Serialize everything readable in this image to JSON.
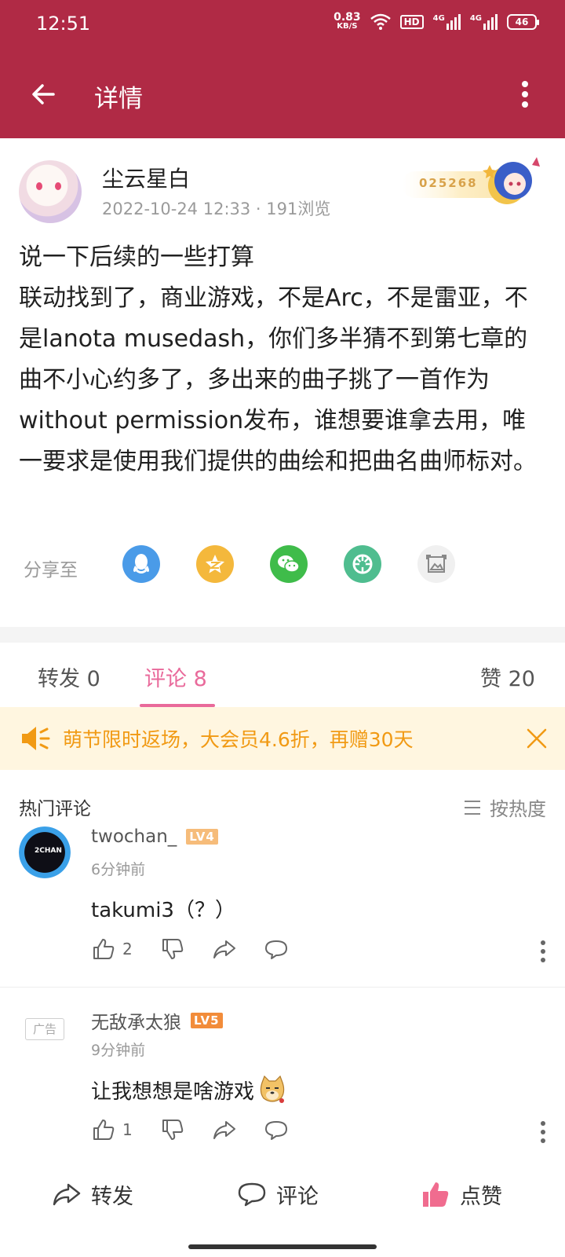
{
  "status": {
    "time": "12:51",
    "net_speed_value": "0.83",
    "net_speed_unit": "KB/S",
    "hd": "HD",
    "net1": "4G",
    "net2": "4G",
    "battery": "46"
  },
  "header": {
    "title": "详情"
  },
  "author": {
    "name": "尘云星白",
    "meta": "2022-10-24 12:33 · 191浏览",
    "fan_number": "025268"
  },
  "post": {
    "lines": [
      "说一下后续的一些打算",
      "联动找到了，商业游戏，不是Arc，不是雷亚，不是lanota musedash，你们多半猜不到第七章的曲不小心约多了，多出来的曲子挑了一首作为without permission发布，谁想要谁拿去用，唯一要求是使用我们提供的曲绘和把曲名曲师标对。"
    ]
  },
  "share": {
    "label": "分享至",
    "targets": [
      {
        "icon": "qq-icon",
        "color": "#4a9be8"
      },
      {
        "icon": "qzone-icon",
        "color": "#f4b83c"
      },
      {
        "icon": "wechat-icon",
        "color": "#3fbc4a"
      },
      {
        "icon": "moments-icon",
        "color": "#4fbd8f"
      },
      {
        "icon": "image-icon",
        "color": "#f0f0f0"
      }
    ]
  },
  "tabs": {
    "repost": "转发 0",
    "comment": "评论 8",
    "like": "赞 20",
    "active": "comment",
    "accent": "#e96a9b"
  },
  "banner": {
    "text": "萌节限时返场，大会员4.6折，再赠30天",
    "color": "#f19a14"
  },
  "comments_section": {
    "title": "热门评论",
    "sort_label": "按热度"
  },
  "comments": [
    {
      "name": "twochan_",
      "level": "LV4",
      "avatar_text": "2CHAN",
      "time": "6分钟前",
      "text": "takumi3（？）",
      "likes": "2"
    },
    {
      "ad_label": "广告",
      "name": "无敌承太狼",
      "level": "LV5",
      "time": "9分钟前",
      "text": "让我想想是啥游戏",
      "likes": "1"
    }
  ],
  "bottom_bar": {
    "repost": "转发",
    "comment": "评论",
    "like": "点赞",
    "like_color": "#f06c8f"
  },
  "theme": {
    "brand": "#b02a45"
  }
}
